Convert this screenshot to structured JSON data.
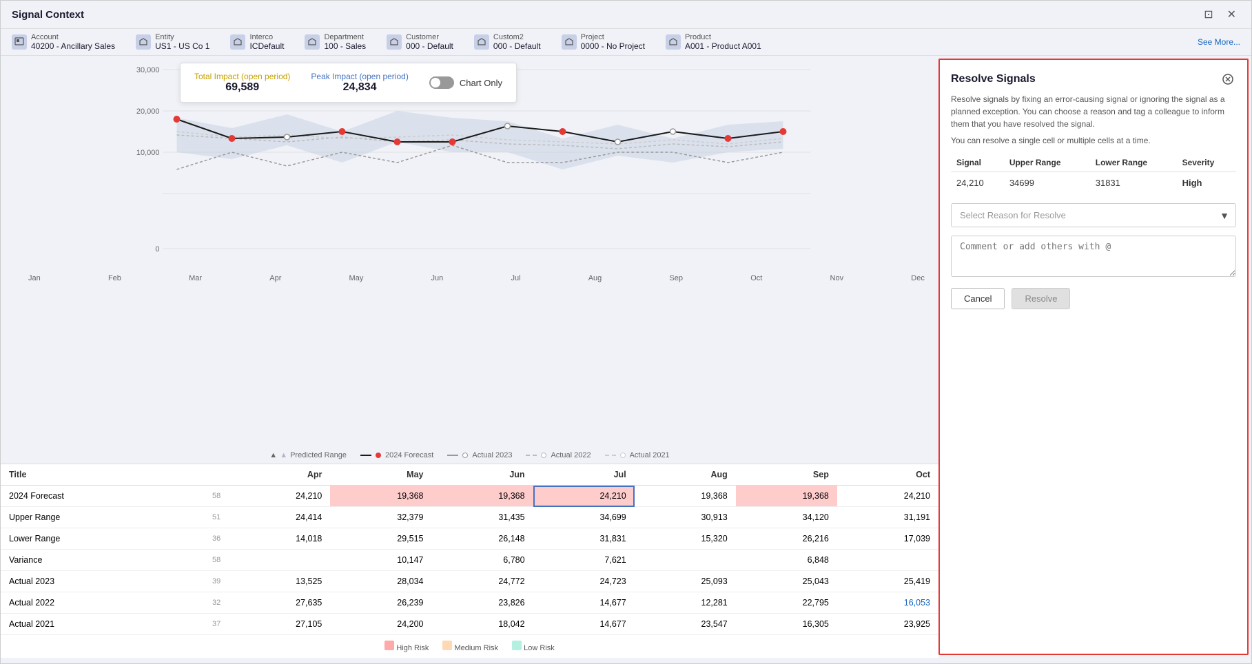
{
  "window": {
    "title": "Signal Context",
    "close_icon": "✕",
    "restore_icon": "⊡"
  },
  "context_bar": {
    "items": [
      {
        "id": "account",
        "label": "Account",
        "value": "40200 - Ancillary Sales"
      },
      {
        "id": "entity",
        "label": "Entity",
        "value": "US1 - US Co 1"
      },
      {
        "id": "interco",
        "label": "Interco",
        "value": "ICDefault"
      },
      {
        "id": "department",
        "label": "Department",
        "value": "100 - Sales"
      },
      {
        "id": "customer",
        "label": "Customer",
        "value": "000 - Default"
      },
      {
        "id": "custom2",
        "label": "Custom2",
        "value": "000 - Default"
      },
      {
        "id": "project",
        "label": "Project",
        "value": "0000 - No Project"
      },
      {
        "id": "product",
        "label": "Product",
        "value": "A001 - Product A001"
      }
    ],
    "see_more_label": "See More..."
  },
  "chart_legend_card": {
    "total_impact_label": "Total Impact (open period)",
    "total_impact_value": "69,589",
    "peak_impact_label": "Peak Impact (open period)",
    "peak_impact_value": "24,834",
    "chart_only_label": "Chart Only"
  },
  "chart": {
    "y_labels": [
      "30,000",
      "20,000",
      "10,000",
      "0"
    ],
    "x_labels": [
      "Jan",
      "Feb",
      "Mar",
      "Apr",
      "May",
      "Jun",
      "Jul",
      "Aug",
      "Sep",
      "Oct",
      "Nov",
      "Dec"
    ]
  },
  "chart_legend": [
    {
      "type": "area",
      "label": "Predicted Range",
      "color": "#b0b8c8"
    },
    {
      "type": "line",
      "label": "2024 Forecast",
      "color": "#1a1a1a"
    },
    {
      "type": "line",
      "label": "Actual 2023",
      "color": "#999",
      "dashed": true
    },
    {
      "type": "line",
      "label": "Actual 2022",
      "color": "#bbb",
      "dashed": true
    },
    {
      "type": "line",
      "label": "Actual 2021",
      "color": "#ccc",
      "dashed": true
    }
  ],
  "data_table": {
    "columns": [
      "Title",
      "",
      "Apr",
      "May",
      "Jun",
      "Jul",
      "Aug",
      "Sep",
      "Oct"
    ],
    "rows": [
      {
        "title": "2024 Forecast",
        "col0": "58",
        "col1": "24,210",
        "col2": "19,368",
        "col3": "19,368",
        "col4": "24,210",
        "col5": "19,368",
        "col6": "19,368",
        "col7": "24,210",
        "highlight": [
          2,
          3,
          4,
          5,
          6
        ]
      },
      {
        "title": "Upper Range",
        "col0": "51",
        "col1": "24,414",
        "col2": "32,379",
        "col3": "31,435",
        "col4": "34,699",
        "col5": "30,913",
        "col6": "34,120",
        "col7": "31,191"
      },
      {
        "title": "Lower Range",
        "col0": "36",
        "col1": "14,018",
        "col2": "29,515",
        "col3": "26,148",
        "col4": "31,831",
        "col5": "15,320",
        "col6": "26,216",
        "col7": "17,039"
      },
      {
        "title": "Variance",
        "col0": "58",
        "col1": "",
        "col2": "10,147",
        "col3": "6,780",
        "col4": "7,621",
        "col5": "",
        "col6": "6,848",
        "col7": ""
      },
      {
        "title": "Actual 2023",
        "col0": "39",
        "col1": "13,525",
        "col2": "28,034",
        "col3": "24,772",
        "col4": "24,723",
        "col5": "25,093",
        "col6": "25,043",
        "col7": "25,419"
      },
      {
        "title": "Actual 2022",
        "col0": "32",
        "col1": "27,635",
        "col2": "26,239",
        "col3": "23,826",
        "col4": "14,677",
        "col5": "12,281",
        "col6": "22,795",
        "col7": "16,053",
        "blueCol": 7
      },
      {
        "title": "Actual 2021",
        "col0": "37",
        "col1": "27,105",
        "col2": "24,200",
        "col3": "18,042",
        "col4": "14,677",
        "col5": "23,547",
        "col6": "16,305",
        "col7": "23,925"
      }
    ],
    "footer_legend": [
      {
        "label": "High Risk",
        "color": "#ffaaaa"
      },
      {
        "label": "Medium Risk",
        "color": "#ffd9b3"
      },
      {
        "label": "Low Risk",
        "color": "#b3f0e0"
      }
    ]
  },
  "resolve_panel": {
    "title": "Resolve Signals",
    "description": "Resolve signals by fixing an error-causing signal or ignoring the signal as a planned exception. You can choose a reason and tag a colleague to inform them that you have resolved the signal.",
    "sub_description": "You can resolve a single cell or multiple cells at a time.",
    "table_headers": [
      "Signal",
      "Upper Range",
      "Lower Range",
      "Severity"
    ],
    "signal_row": {
      "signal": "24,210",
      "upper_range": "34699",
      "lower_range": "31831",
      "severity": "High"
    },
    "select_reason_placeholder": "Select Reason for Resolve",
    "comment_placeholder": "Comment or add others with @",
    "cancel_label": "Cancel",
    "resolve_label": "Resolve",
    "close_icon": "⊗"
  }
}
